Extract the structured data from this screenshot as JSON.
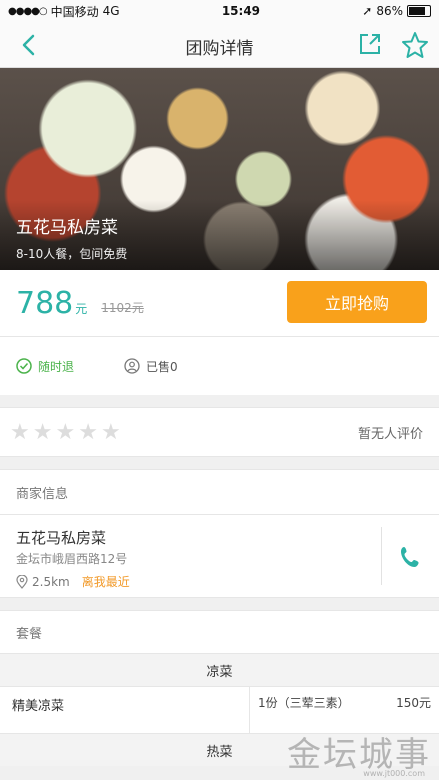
{
  "status_bar": {
    "carrier": "中国移动",
    "network": "4G",
    "time": "15:49",
    "battery": "86%"
  },
  "nav": {
    "title": "团购详情"
  },
  "deal": {
    "name": "五花马私房菜",
    "description": "8-10人餐，包间免费",
    "price": "788",
    "price_unit": "元",
    "original_price": "1102元",
    "buy_label": "立即抢购"
  },
  "tags": {
    "refund": "随时退",
    "sold": "已售0"
  },
  "rating": {
    "stars": 0,
    "text": "暂无人评价"
  },
  "merchant": {
    "section_title": "商家信息",
    "name": "五花马私房菜",
    "address": "金坛市峨眉西路12号",
    "distance": "2.5km",
    "nearest": "离我最近"
  },
  "package": {
    "section_title": "套餐",
    "categories": [
      {
        "title": "凉菜",
        "items": [
          {
            "name": "精美凉菜",
            "qty": "1份（三荤三素）",
            "price": "150元"
          }
        ]
      },
      {
        "title": "热菜",
        "items": []
      }
    ]
  },
  "watermark": {
    "text": "金坛城事",
    "url": "www.jt000.com"
  },
  "colors": {
    "accent": "#2cb2a6",
    "buy_button": "#f9a11b",
    "green": "#4bb34b",
    "orange": "#f29a2a"
  }
}
